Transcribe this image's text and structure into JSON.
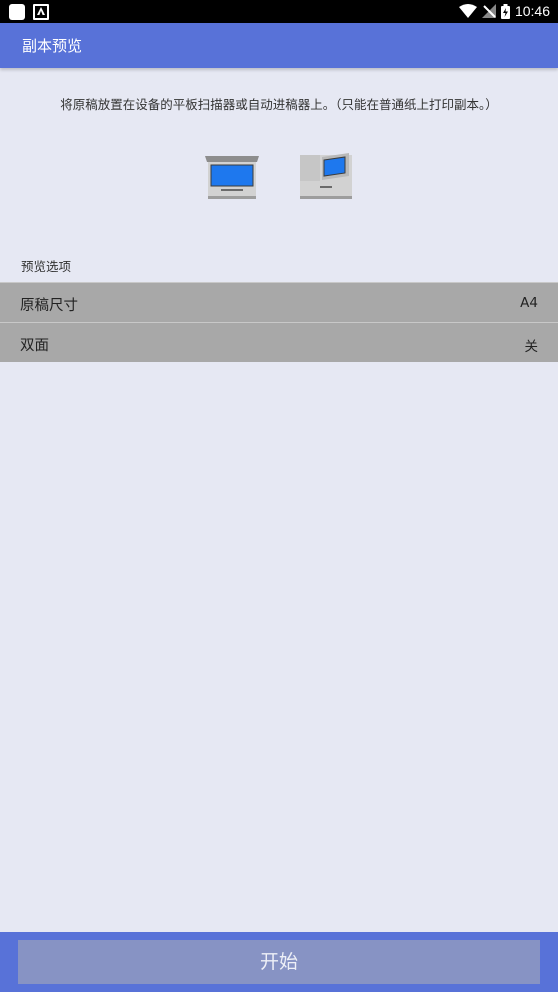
{
  "status_bar": {
    "time": "10:46"
  },
  "app_bar": {
    "title": "副本预览"
  },
  "instruction": "将原稿放置在设备的平板扫描器或自动进稿器上。（只能在普通纸上打印副本。）",
  "preview_options": {
    "header": "预览选项",
    "items": [
      {
        "label": "原稿尺寸",
        "value": "A4"
      },
      {
        "label": "双面",
        "value": "关"
      }
    ]
  },
  "start_label": "开始",
  "colors": {
    "accent": "#5872d8",
    "background": "#e6e8f3",
    "row": "#a8a8a8",
    "button": "#8793c4"
  }
}
